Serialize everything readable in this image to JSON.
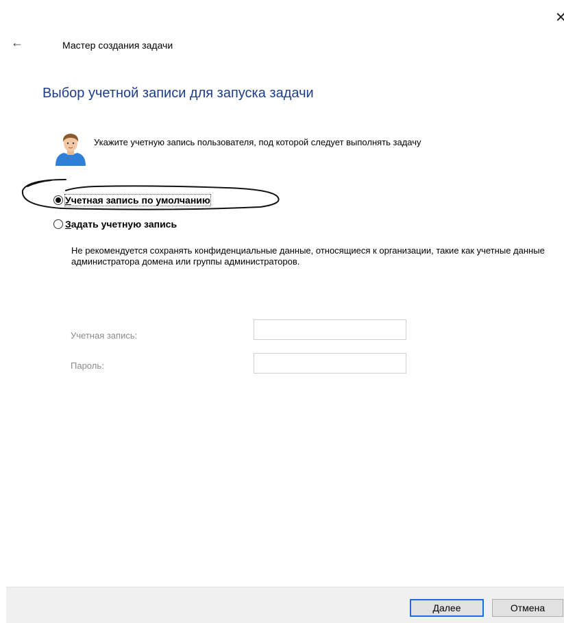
{
  "window": {
    "close_glyph": "✕",
    "back_glyph": "←",
    "title": "Мастер создания задачи"
  },
  "page": {
    "heading": "Выбор учетной записи для запуска задачи",
    "instruction": "Укажите учетную запись пользователя, под которой следует выполнять задачу",
    "user_icon": "user-avatar-icon"
  },
  "options": {
    "default_account": {
      "label_first": "У",
      "label_rest": "четная запись по умолчанию",
      "selected": true
    },
    "custom_account": {
      "label_first": "З",
      "label_rest": "адать учетную запись",
      "selected": false
    }
  },
  "warning": "Не рекомендуется сохранять конфиденциальные данные, относящиеся к организации, такие как учетные данные администратора домена или группы администраторов.",
  "fields": {
    "account_label": "Учетная запись:",
    "account_value": "",
    "password_label": "Пароль:",
    "password_value": ""
  },
  "buttons": {
    "next_first": "Д",
    "next_rest": "алее",
    "cancel": "Отмена"
  },
  "colors": {
    "heading": "#1c3c8a",
    "default_button_border": "#1a6ed8",
    "footer_bg": "#f0f0f0"
  }
}
